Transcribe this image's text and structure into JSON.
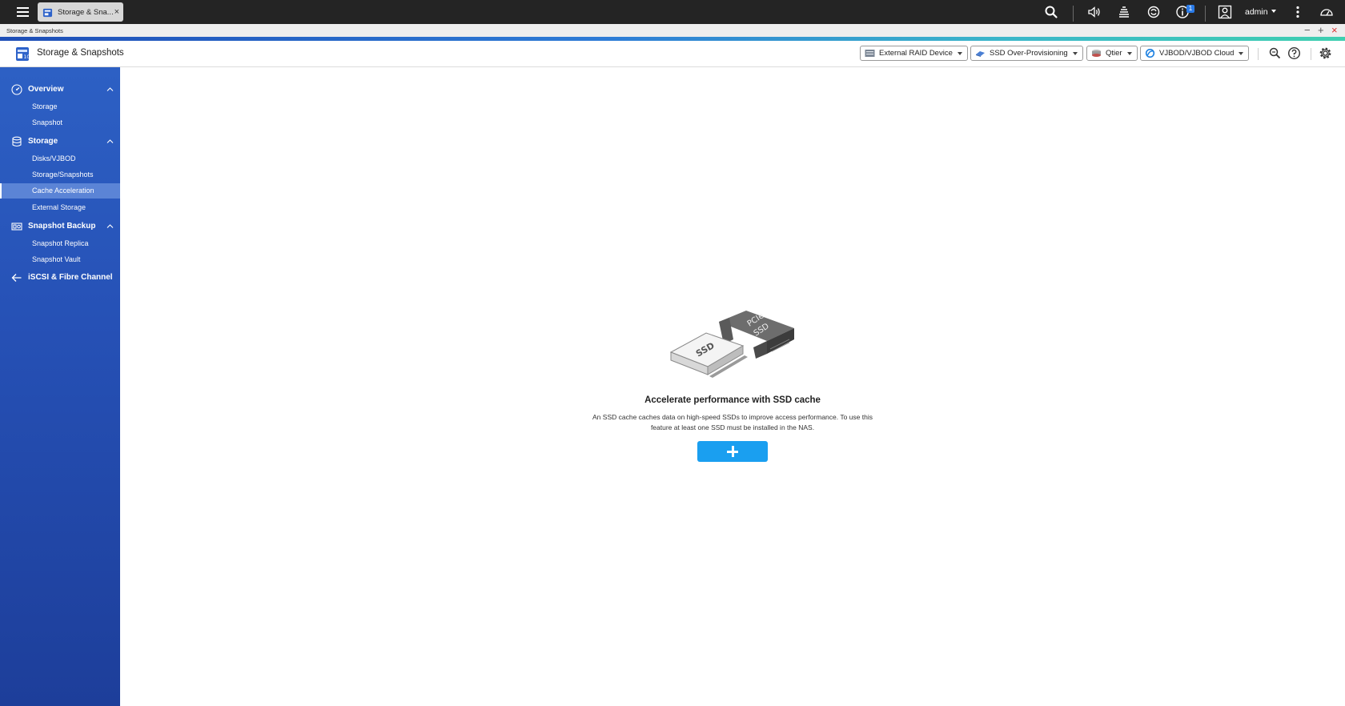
{
  "os_bar": {
    "tab_label": "Storage & Sna...",
    "tab_close": "×",
    "notification_count": "1",
    "user": "admin"
  },
  "window": {
    "title": "Storage & Snapshots",
    "controls": {
      "minimize": "−",
      "maximize": "+",
      "close": "×"
    }
  },
  "header": {
    "title": "Storage & Snapshots",
    "toolbar": [
      {
        "label": "External RAID Device",
        "icon": "raid-device-icon"
      },
      {
        "label": "SSD Over-Provisioning",
        "icon": "ssd-icon"
      },
      {
        "label": "Qtier",
        "icon": "qtier-icon"
      },
      {
        "label": "VJBOD/VJBOD Cloud",
        "icon": "cloud-icon"
      }
    ]
  },
  "sidebar": {
    "sections": [
      {
        "label": "Overview",
        "icon": "gauge-icon",
        "items": [
          "Storage",
          "Snapshot"
        ]
      },
      {
        "label": "Storage",
        "icon": "database-icon",
        "items": [
          "Disks/VJBOD",
          "Storage/Snapshots",
          "Cache Acceleration",
          "External Storage"
        ]
      },
      {
        "label": "Snapshot Backup",
        "icon": "snapshot-backup-icon",
        "items": [
          "Snapshot Replica",
          "Snapshot Vault"
        ]
      },
      {
        "label": "iSCSI & Fibre Channel",
        "icon": "iscsi-icon",
        "items": []
      }
    ],
    "active_item": "Cache Acceleration"
  },
  "main": {
    "illustration": {
      "ssd_label": "SSD",
      "pcie_label": "PCIe",
      "pcie_ssd_label": "SSD"
    },
    "headline": "Accelerate performance with SSD cache",
    "description_line1": "An SSD cache caches data on high-speed SSDs to improve access performance. To use this",
    "description_line2": "feature at least one SSD must be installed in the NAS.",
    "add_button_icon": "plus-icon"
  },
  "colors": {
    "sidebar": "#2651b6",
    "sidebar_active": "#5b84d6",
    "accent": "#1a9ff0",
    "os_bar": "#242424"
  }
}
